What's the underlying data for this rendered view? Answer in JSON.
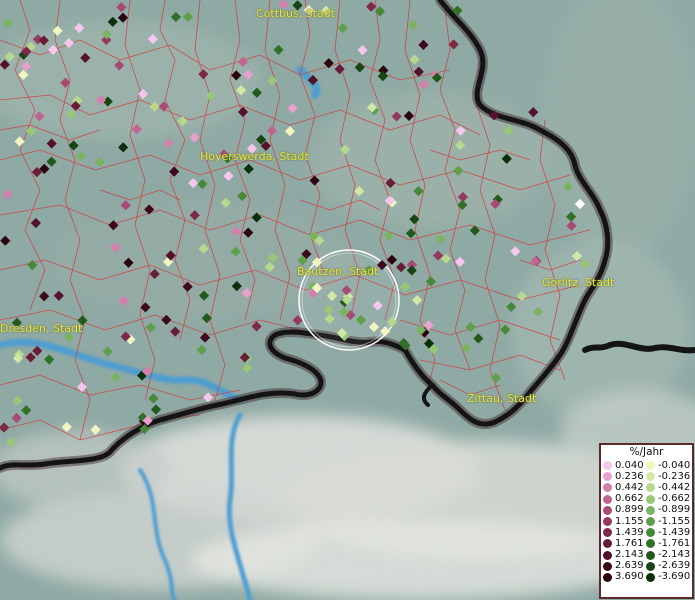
{
  "legend": {
    "title": "%/Jahr",
    "positive": [
      {
        "value": "0.040",
        "color": "#f5c6ee"
      },
      {
        "value": "0.236",
        "color": "#e8a1cc"
      },
      {
        "value": "0.442",
        "color": "#d480ad"
      },
      {
        "value": "0.662",
        "color": "#c06490"
      },
      {
        "value": "0.899",
        "color": "#a84a76"
      },
      {
        "value": "1.155",
        "color": "#93385f"
      },
      {
        "value": "1.439",
        "color": "#7c2849"
      },
      {
        "value": "1.761",
        "color": "#681c38"
      },
      {
        "value": "2.143",
        "color": "#531229"
      },
      {
        "value": "2.639",
        "color": "#3d0a1c"
      },
      {
        "value": "3.690",
        "color": "#2a0510"
      }
    ],
    "negative": [
      {
        "value": "-0.040",
        "color": "#f1f6c0"
      },
      {
        "value": "-0.236",
        "color": "#d3e8a6"
      },
      {
        "value": "-0.442",
        "color": "#b7d98f"
      },
      {
        "value": "-0.662",
        "color": "#98c777"
      },
      {
        "value": "-0.899",
        "color": "#7bb461"
      },
      {
        "value": "-1.155",
        "color": "#5f9f4b"
      },
      {
        "value": "-1.439",
        "color": "#468838"
      },
      {
        "value": "-1.761",
        "color": "#317127"
      },
      {
        "value": "-2.143",
        "color": "#215a1b"
      },
      {
        "value": "-2.639",
        "color": "#144512"
      },
      {
        "value": "-3.690",
        "color": "#0a300b"
      }
    ]
  },
  "cities": [
    {
      "name": "Cottbus, Stadt"
    },
    {
      "name": "Hoyerswerda, Stadt"
    },
    {
      "name": "Bautzen, Stadt"
    },
    {
      "name": "Görlitz, Stadt"
    },
    {
      "name": "Dresden, Stadt"
    },
    {
      "name": "Zittau, Stadt"
    }
  ],
  "map_colors": {
    "land": "#8fa9a4",
    "mountains": "#d9dcd8",
    "river": "#4f9ed0",
    "district_borders": "#d23a3a",
    "national_border": "#141414",
    "highlight_ring": "#ffffff"
  }
}
